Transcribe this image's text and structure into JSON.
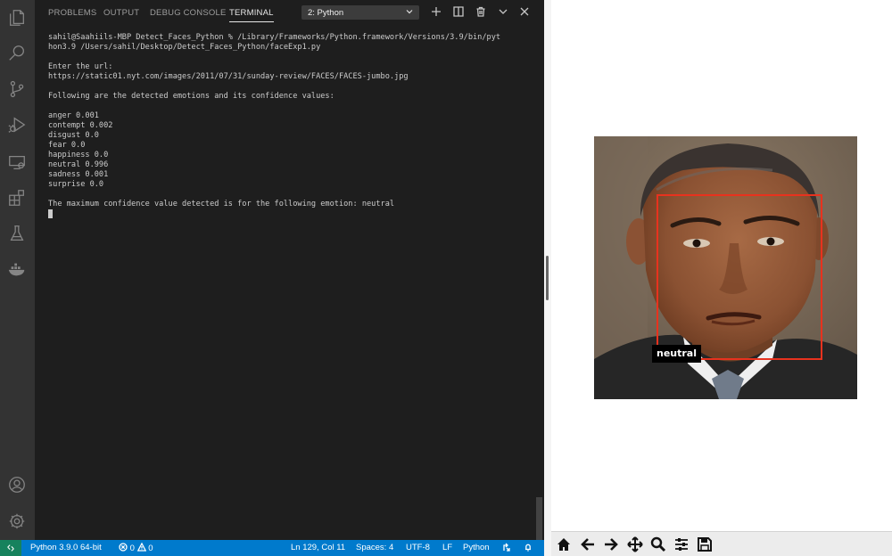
{
  "vscode": {
    "activity_bar": {
      "icons": [
        "explorer-icon",
        "search-icon",
        "source-control-icon",
        "run-debug-icon",
        "remote-explorer-icon",
        "extensions-icon",
        "testing-icon",
        "docker-icon",
        "account-icon",
        "settings-gear-icon"
      ]
    },
    "panel": {
      "tabs": [
        {
          "label": "PROBLEMS",
          "active": false
        },
        {
          "label": "OUTPUT",
          "active": false
        },
        {
          "label": "DEBUG CONSOLE",
          "active": false
        },
        {
          "label": "TERMINAL",
          "active": true
        }
      ],
      "terminal_selector": "2: Python",
      "header_icons": [
        "plus-icon",
        "split-terminal-icon",
        "trash-icon",
        "chevron-down-icon",
        "close-icon"
      ]
    },
    "terminal": {
      "lines": [
        "sahil@Saahiils-MBP Detect_Faces_Python % /Library/Frameworks/Python.framework/Versions/3.9/bin/pyt",
        "hon3.9 /Users/sahil/Desktop/Detect_Faces_Python/faceExp1.py",
        "",
        "Enter the url:",
        "https://static01.nyt.com/images/2011/07/31/sunday-review/FACES/FACES-jumbo.jpg",
        "",
        "Following are the detected emotions and its confidence values:",
        "",
        "anger 0.001",
        "contempt 0.002",
        "disgust 0.0",
        "fear 0.0",
        "happiness 0.0",
        "neutral 0.996",
        "sadness 0.001",
        "surprise 0.0",
        "",
        "The maximum confidence value detected is for the following emotion: neutral"
      ]
    },
    "status_bar": {
      "interpreter": "Python 3.9.0 64-bit",
      "errors": "0",
      "warnings": "0",
      "cursor_position": "Ln 129, Col 11",
      "indentation": "Spaces: 4",
      "encoding": "UTF-8",
      "line_ending": "LF",
      "language": "Python",
      "colors": {
        "background": "#007acc",
        "remote": "#16825d"
      }
    }
  },
  "figure": {
    "annotation_label": "neutral",
    "box_color": "#e8321e",
    "toolbar_icons": [
      "home-icon",
      "back-arrow-icon",
      "forward-arrow-icon",
      "pan-move-icon",
      "zoom-icon",
      "configure-subplots-icon",
      "save-icon"
    ]
  }
}
